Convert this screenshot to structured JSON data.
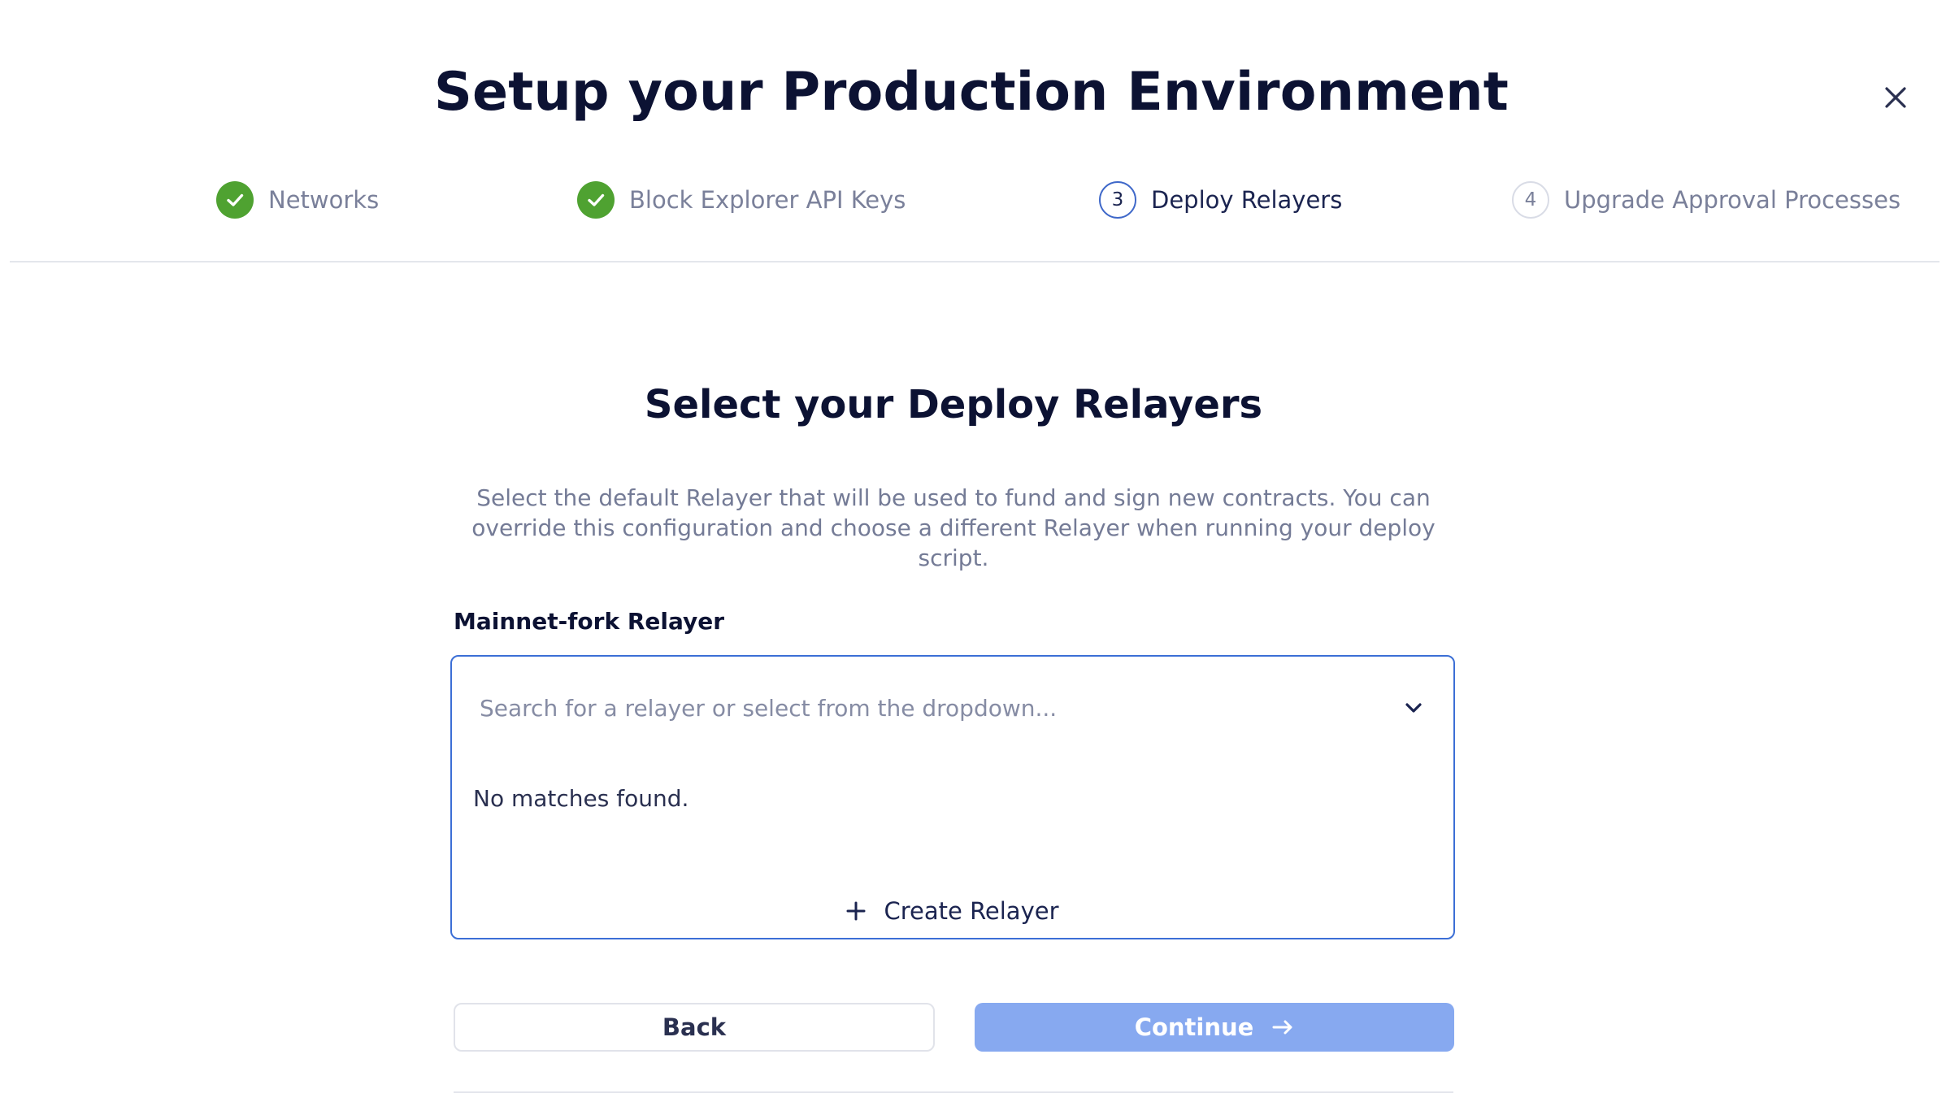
{
  "header": {
    "title": "Setup your Production Environment"
  },
  "stepper": {
    "steps": [
      {
        "number": "1",
        "label": "Networks",
        "status": "completed"
      },
      {
        "number": "2",
        "label": "Block Explorer API Keys",
        "status": "completed"
      },
      {
        "number": "3",
        "label": "Deploy Relayers",
        "status": "current"
      },
      {
        "number": "4",
        "label": "Upgrade Approval Processes",
        "status": "pending"
      }
    ]
  },
  "section": {
    "title": "Select your Deploy Relayers",
    "description": "Select the default Relayer that will be used to fund and sign new contracts. You can override this configuration and choose a different Relayer when running your deploy script."
  },
  "relayer_field": {
    "label": "Mainnet-fork Relayer",
    "value": "",
    "placeholder": "Search for a relayer or select from the dropdown...",
    "empty_message": "No matches found.",
    "create_label": "Create Relayer"
  },
  "actions": {
    "back_label": "Back",
    "continue_label": "Continue"
  },
  "icons": {
    "close": "close-icon",
    "completed": "check-circle-icon",
    "chevron": "chevron-down-icon",
    "create": "plus-icon",
    "continue": "arrow-right-icon"
  },
  "colors": {
    "success": "#4fa231",
    "accent": "#3c6fd6",
    "primary_disabled": "#87a9f0",
    "heading": "#0c1233",
    "muted_text": "#747b96"
  }
}
